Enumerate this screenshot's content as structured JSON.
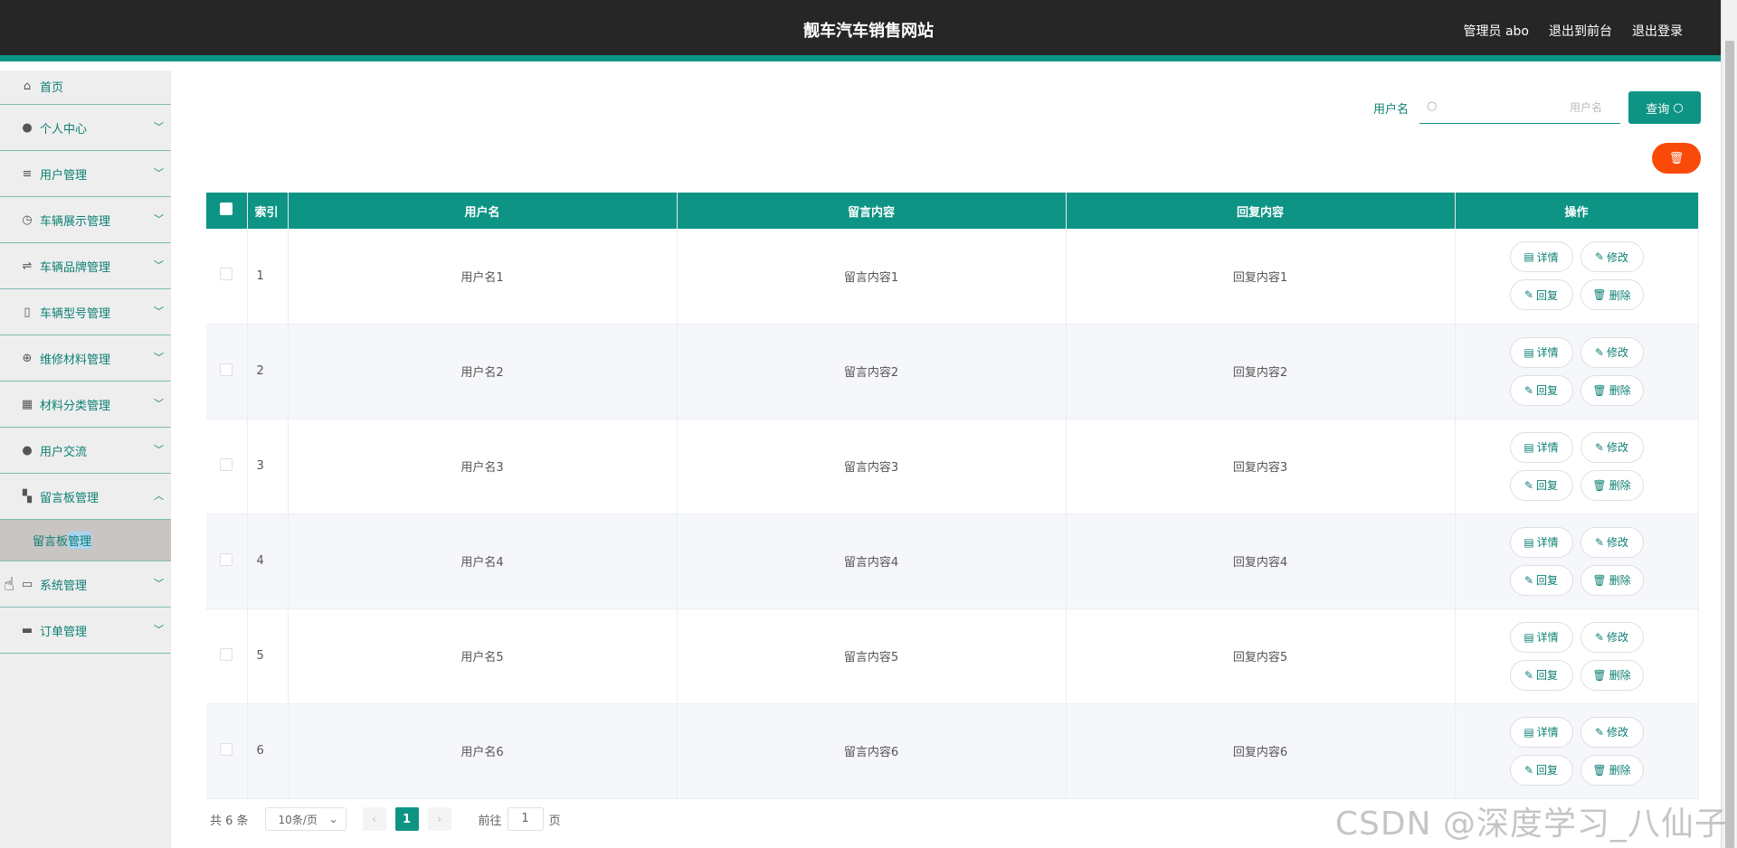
{
  "header": {
    "title": "靓车汽车销售网站",
    "links": [
      "管理员 abo",
      "退出到前台",
      "退出登录"
    ]
  },
  "sidebar": {
    "items": [
      {
        "label": "首页",
        "icon": "home-icon",
        "chevron": ""
      },
      {
        "label": "个人中心",
        "icon": "user-icon",
        "chevron": "﹀"
      },
      {
        "label": "用户管理",
        "icon": "list-icon",
        "chevron": "﹀"
      },
      {
        "label": "车辆展示管理",
        "icon": "clock-icon",
        "chevron": "﹀"
      },
      {
        "label": "车辆品牌管理",
        "icon": "sliders-icon",
        "chevron": "﹀"
      },
      {
        "label": "车辆型号管理",
        "icon": "mic-icon",
        "chevron": "﹀"
      },
      {
        "label": "维修材料管理",
        "icon": "aperture-icon",
        "chevron": "﹀"
      },
      {
        "label": "材料分类管理",
        "icon": "grid-icon",
        "chevron": "﹀"
      },
      {
        "label": "用户交流",
        "icon": "user-icon",
        "chevron": "﹀"
      },
      {
        "label": "留言板管理",
        "icon": "apps-icon",
        "chevron": "︿"
      }
    ],
    "submenu": {
      "label_a": "留言板",
      "label_b": "管理"
    },
    "items_after": [
      {
        "label": "系统管理",
        "icon": "monitor-icon",
        "chevron": "﹀"
      },
      {
        "label": "订单管理",
        "icon": "chat-icon",
        "chevron": "﹀"
      }
    ]
  },
  "search": {
    "label": "用户名",
    "placeholder": "用户名",
    "button": "查询"
  },
  "delete_all_icon": "trash-icon",
  "table": {
    "columns": [
      "索引",
      "用户名",
      "留言内容",
      "回复内容",
      "操作"
    ],
    "rows": [
      {
        "index": "1",
        "username": "用户名1",
        "message": "留言内容1",
        "reply": "回复内容1"
      },
      {
        "index": "2",
        "username": "用户名2",
        "message": "留言内容2",
        "reply": "回复内容2"
      },
      {
        "index": "3",
        "username": "用户名3",
        "message": "留言内容3",
        "reply": "回复内容3"
      },
      {
        "index": "4",
        "username": "用户名4",
        "message": "留言内容4",
        "reply": "回复内容4"
      },
      {
        "index": "5",
        "username": "用户名5",
        "message": "留言内容5",
        "reply": "回复内容5"
      },
      {
        "index": "6",
        "username": "用户名6",
        "message": "留言内容6",
        "reply": "回复内容6"
      }
    ],
    "actions": [
      "详情",
      "修改",
      "回复",
      "删除"
    ]
  },
  "pagination": {
    "total": "共 6 条",
    "page_size": "10条/页",
    "current_page": "1",
    "goto_prefix": "前往",
    "goto_value": "1",
    "goto_suffix": "页"
  },
  "watermark": "CSDN @深度学习_八仙子",
  "colors": {
    "primary": "#0e9485",
    "danger": "#fa4a0a",
    "header": "#262626"
  }
}
